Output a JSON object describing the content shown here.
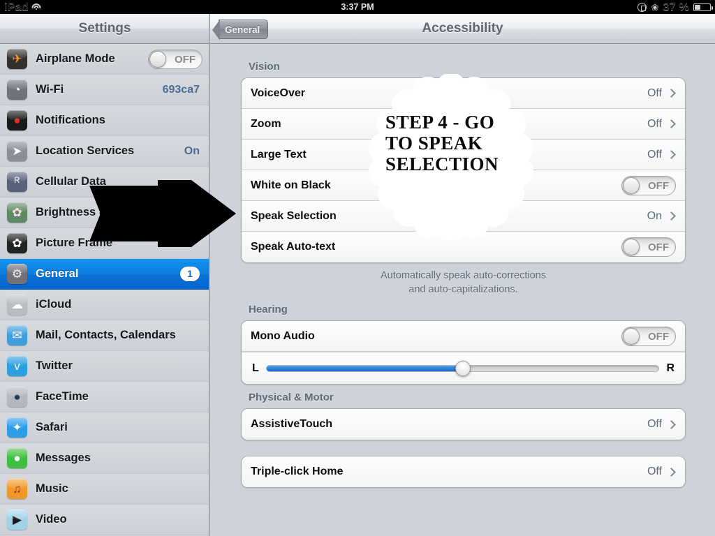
{
  "statusbar": {
    "device": "iPad",
    "wifi_icon": "wifi-icon",
    "time": "3:37 PM",
    "rotation_lock_icon": "rotation-lock-icon",
    "bluetooth_icon": "bluetooth-icon",
    "battery_percent": "37 %",
    "battery_icon": "battery-icon"
  },
  "sidebar": {
    "title": "Settings",
    "items": [
      {
        "label": "Airplane Mode",
        "icon": "airplane-icon",
        "icon_bg": "#33312e",
        "glyph": "✈",
        "glyph_color": "#f79021",
        "control": "toggle",
        "toggle_label": "OFF",
        "value": ""
      },
      {
        "label": "Wi-Fi",
        "icon": "wifi-icon",
        "icon_bg": "#6e737a",
        "glyph": "◔",
        "glyph_color": "#ffffff",
        "control": "value",
        "value": "693ca7"
      },
      {
        "label": "Notifications",
        "icon": "notifications-icon",
        "icon_bg": "#1a1a1a",
        "glyph": "●",
        "glyph_color": "#e02b20",
        "control": "none",
        "value": ""
      },
      {
        "label": "Location Services",
        "icon": "location-icon",
        "icon_bg": "#8a8f96",
        "glyph": "➤",
        "glyph_color": "#ffffff",
        "control": "value",
        "value": "On"
      },
      {
        "label": "Cellular Data",
        "icon": "cellular-icon",
        "icon_bg": "#59607c",
        "glyph": "ᴿ",
        "glyph_color": "#ffffff",
        "control": "none",
        "value": ""
      },
      {
        "label": "Brightness &",
        "icon": "brightness-wallpaper-icon",
        "icon_bg": "#5d8a64",
        "glyph": "✿",
        "glyph_color": "#ffd8e8",
        "control": "none",
        "value": ""
      },
      {
        "label": "Picture Frame",
        "icon": "picture-frame-icon",
        "icon_bg": "#232323",
        "glyph": "✿",
        "glyph_color": "#ffffff",
        "control": "none",
        "value": ""
      },
      {
        "label": "General",
        "icon": "general-gear-icon",
        "icon_bg": "#707277",
        "glyph": "⚙",
        "glyph_color": "#efefef",
        "control": "badge",
        "badge": "1",
        "value": "",
        "selected": true
      },
      {
        "label": "iCloud",
        "icon": "icloud-icon",
        "icon_bg": "#b9bdc2",
        "glyph": "☁",
        "glyph_color": "#ffffff",
        "control": "none",
        "value": ""
      },
      {
        "label": "Mail, Contacts, Calendars",
        "icon": "mail-icon",
        "icon_bg": "#3e9ede",
        "glyph": "✉",
        "glyph_color": "#ffffff",
        "control": "none",
        "value": ""
      },
      {
        "label": "Twitter",
        "icon": "twitter-icon",
        "icon_bg": "#2b9fe0",
        "glyph": "ᴠ",
        "glyph_color": "#ffffff",
        "control": "none",
        "value": ""
      },
      {
        "label": "FaceTime",
        "icon": "facetime-icon",
        "icon_bg": "#b4b8bd",
        "glyph": "●",
        "glyph_color": "#1e3a5c",
        "control": "none",
        "value": ""
      },
      {
        "label": "Safari",
        "icon": "safari-icon",
        "icon_bg": "#2e9de8",
        "glyph": "✦",
        "glyph_color": "#ffffff",
        "control": "none",
        "value": ""
      },
      {
        "label": "Messages",
        "icon": "messages-icon",
        "icon_bg": "#3fbf3f",
        "glyph": "●",
        "glyph_color": "#ffffff",
        "control": "none",
        "value": ""
      },
      {
        "label": "Music",
        "icon": "music-icon",
        "icon_bg": "#f0992a",
        "glyph": "♫",
        "glyph_color": "#9c2b12",
        "control": "none",
        "value": ""
      },
      {
        "label": "Video",
        "icon": "video-icon",
        "icon_bg": "#9fd2e8",
        "glyph": "▶",
        "glyph_color": "#1b1b1b",
        "control": "none",
        "value": ""
      }
    ]
  },
  "content": {
    "back_button": "General",
    "title": "Accessibility",
    "sections": [
      {
        "title": "Vision",
        "rows": [
          {
            "label": "VoiceOver",
            "control": "disclosure",
            "value": "Off"
          },
          {
            "label": "Zoom",
            "control": "disclosure",
            "value": "Off"
          },
          {
            "label": "Large Text",
            "control": "disclosure",
            "value": "Off"
          },
          {
            "label": "White on Black",
            "control": "toggle",
            "toggle_label": "OFF"
          },
          {
            "label": "Speak Selection",
            "control": "disclosure",
            "value": "On"
          },
          {
            "label": "Speak Auto-text",
            "control": "toggle",
            "toggle_label": "OFF"
          }
        ],
        "footnote": "Automatically speak auto-corrections\nand auto-capitalizations."
      },
      {
        "title": "Hearing",
        "rows": [
          {
            "label": "Mono Audio",
            "control": "toggle",
            "toggle_label": "OFF"
          }
        ],
        "slider": {
          "left_label": "L",
          "right_label": "R",
          "value_percent": 50
        }
      },
      {
        "title": "Physical & Motor",
        "rows": [
          {
            "label": "AssistiveTouch",
            "control": "disclosure",
            "value": "Off"
          }
        ]
      },
      {
        "title": "",
        "rows": [
          {
            "label": "Triple-click Home",
            "control": "disclosure",
            "value": "Off"
          }
        ]
      }
    ]
  },
  "annotations": {
    "arrow": {
      "icon": "right-arrow-annotation",
      "color": "#000000"
    },
    "callout": {
      "icon": "cloud-callout-annotation",
      "color": "#ffffff",
      "lines": [
        "STEP 4 - GO",
        "TO SPEAK",
        "SELECTION"
      ]
    }
  }
}
